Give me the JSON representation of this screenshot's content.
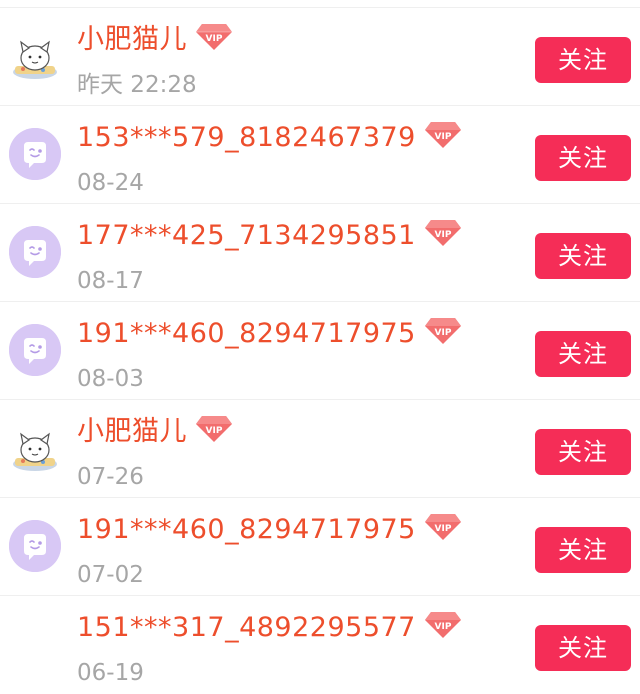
{
  "follow_list": {
    "follow_label": "关注",
    "items": [
      {
        "name": "小肥猫儿",
        "time": "昨天 22:28",
        "avatar": "cat-sticker-icon",
        "vip": true
      },
      {
        "name": "153***579_8182467379",
        "time": "08-24",
        "avatar": "default-chat-bubble-icon",
        "vip": true
      },
      {
        "name": "177***425_7134295851",
        "time": "08-17",
        "avatar": "default-chat-bubble-icon",
        "vip": true
      },
      {
        "name": "191***460_8294717975",
        "time": "08-03",
        "avatar": "default-chat-bubble-icon",
        "vip": true
      },
      {
        "name": "小肥猫儿",
        "time": "07-26",
        "avatar": "cat-sticker-icon",
        "vip": true
      },
      {
        "name": "191***460_8294717975",
        "time": "07-02",
        "avatar": "default-chat-bubble-icon",
        "vip": true
      },
      {
        "name": "151***317_4892295577",
        "time": "06-19",
        "avatar": "none",
        "vip": true
      }
    ]
  },
  "colors": {
    "name": "#ed4e2c",
    "time": "#a6a6a6",
    "follow_button": "#f52d57",
    "avatar_default": "#d8c8f5",
    "vip_badge": "#f26d6d"
  }
}
